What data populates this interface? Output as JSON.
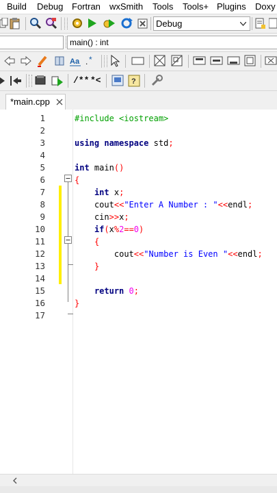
{
  "menubar": {
    "items": [
      "Build",
      "Debug",
      "Fortran",
      "wxSmith",
      "Tools",
      "Tools+",
      "Plugins",
      "Doxy"
    ]
  },
  "toolbar": {
    "build_target": "Debug",
    "scope_value": "main() : int",
    "comment_labels": [
      "/**",
      "*<"
    ]
  },
  "tab": {
    "label": "*main.cpp"
  },
  "editor": {
    "lines": [
      {
        "n": "1",
        "code": "#include <iostream>"
      },
      {
        "n": "2",
        "code": ""
      },
      {
        "n": "3",
        "code": "using namespace std;"
      },
      {
        "n": "4",
        "code": ""
      },
      {
        "n": "5",
        "code": "int main()"
      },
      {
        "n": "6",
        "code": "{"
      },
      {
        "n": "7",
        "code": "    int x;"
      },
      {
        "n": "8",
        "code": "    cout<<\"Enter A Number : \"<<endl;"
      },
      {
        "n": "9",
        "code": "    cin>>x;"
      },
      {
        "n": "10",
        "code": "    if(x%2==0)"
      },
      {
        "n": "11",
        "code": "    {"
      },
      {
        "n": "12",
        "code": "        cout<<\"Number is Even \"<<endl;"
      },
      {
        "n": "13",
        "code": "    }"
      },
      {
        "n": "14",
        "code": ""
      },
      {
        "n": "15",
        "code": "    return 0;"
      },
      {
        "n": "16",
        "code": "}"
      },
      {
        "n": "17",
        "code": ""
      }
    ]
  },
  "colors": {
    "keyword": "#000080",
    "preprocessor": "#00a000",
    "string": "#0000ff",
    "operator": "#ff0000",
    "number": "#f000f0",
    "changed_marker": "#ffee00"
  }
}
